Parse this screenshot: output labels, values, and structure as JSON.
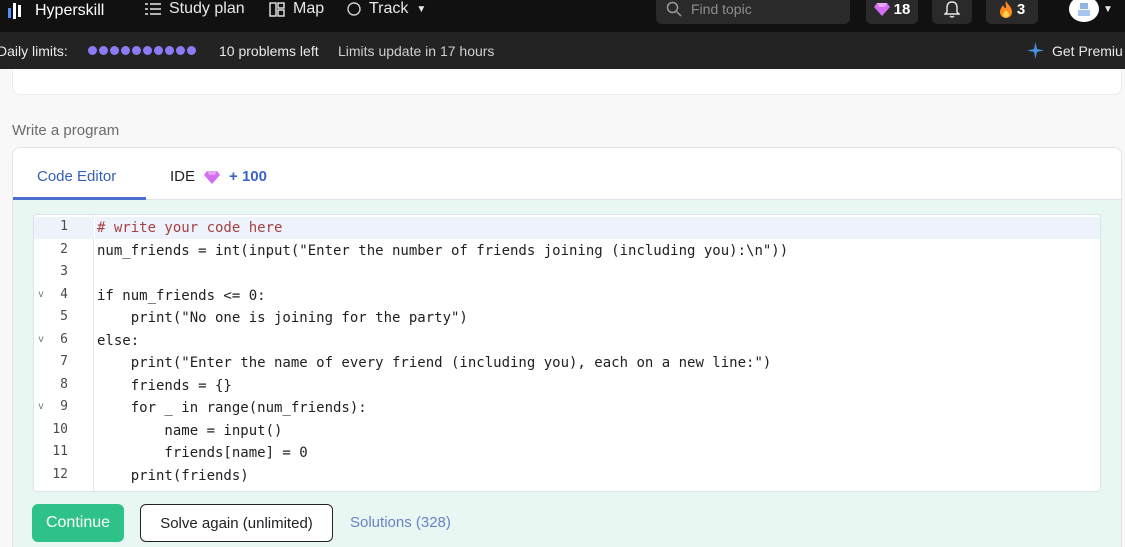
{
  "nav": {
    "brand": "Hyperskill",
    "study_plan": "Study plan",
    "map": "Map",
    "track": "Track",
    "search_placeholder": "Find topic",
    "gems": "18",
    "streak": "3",
    "colors": {
      "background": "#111111",
      "gem": "#d36df2",
      "fire": "#ff8a1f"
    }
  },
  "limits": {
    "label": "Daily limits:",
    "dot_count": 10,
    "problems_left": "10 problems left",
    "update_text": "Limits update in 17 hours",
    "premium_text": "Get Premiu",
    "colors": {
      "dots": "#8b7cf6",
      "premium_icon": "#4a90e2"
    }
  },
  "task": {
    "section_title": "Write a program",
    "tabs": {
      "code_editor": "Code Editor",
      "ide": "IDE",
      "ide_reward": "+ 100"
    },
    "code": {
      "line_numbers": [
        "1",
        "2",
        "3",
        "4",
        "5",
        "6",
        "7",
        "8",
        "9",
        "10",
        "11",
        "12"
      ],
      "fold_markers": [
        "",
        "",
        "",
        "v",
        "",
        "v",
        "",
        "",
        "v",
        "",
        "",
        ""
      ],
      "lines": [
        "# write your code here",
        "num_friends = int(input(\"Enter the number of friends joining (including you):\\n\"))",
        "",
        "if num_friends <= 0:",
        "    print(\"No one is joining for the party\")",
        "else:",
        "    print(\"Enter the name of every friend (including you), each on a new line:\")",
        "    friends = {}",
        "    for _ in range(num_friends):",
        "        name = input()",
        "        friends[name] = 0",
        "    print(friends)"
      ]
    },
    "buttons": {
      "continue": "Continue",
      "solve_again": "Solve again (unlimited)",
      "solutions": "Solutions (328)"
    },
    "colors": {
      "accent": "#2ec28a",
      "editor_bg": "#e8f7f1",
      "tab_active": "#3560b8"
    }
  }
}
